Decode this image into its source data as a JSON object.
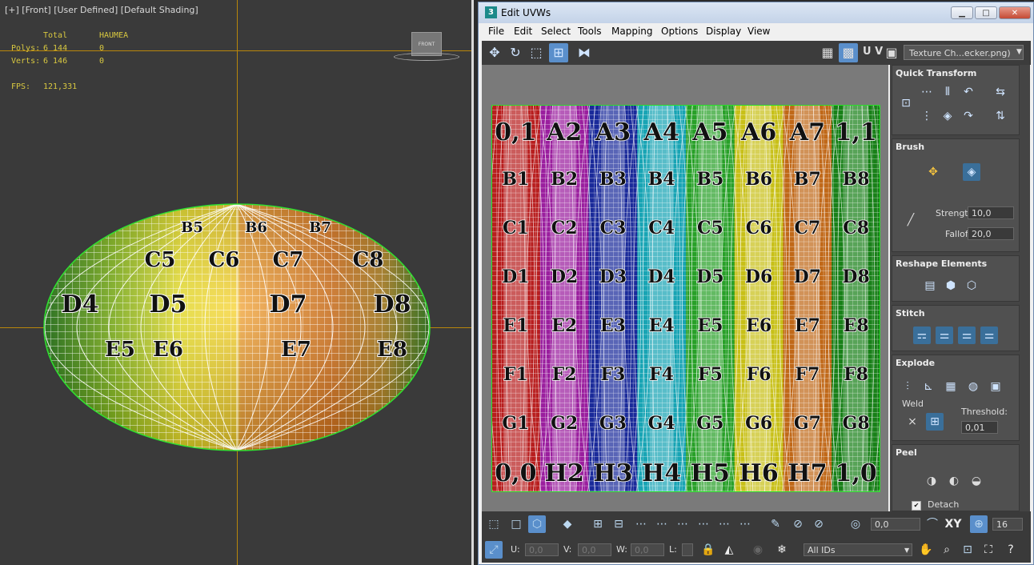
{
  "viewport": {
    "label": "[+] [Front] [User Defined] [Default Shading]",
    "stats": {
      "col_total": "Total",
      "col_object": "HAUMEA",
      "polys_label": "Polys:",
      "polys_total": "6 144",
      "polys_object": "0",
      "verts_label": "Verts:",
      "verts_total": "6 146",
      "verts_object": "0",
      "fps_label": "FPS:",
      "fps_value": "121,331"
    },
    "viewcube_label": "FRONT",
    "sphere_text": {
      "row1": [
        "B5",
        "B6",
        "B7"
      ],
      "row2": [
        "C5",
        "C6",
        "C7",
        "C8"
      ],
      "row3": [
        "D4",
        "D5",
        "D7",
        "D8"
      ],
      "row4": [
        "E5",
        "E6",
        "E7",
        "E8"
      ]
    }
  },
  "window": {
    "title": "Edit UVWs",
    "icon": "3",
    "controls": [
      "minimize-icon",
      "maximize-icon",
      "close-icon"
    ]
  },
  "menu": [
    "File",
    "Edit",
    "Select",
    "Tools",
    "Mapping",
    "Options",
    "Display",
    "View"
  ],
  "toolbar": {
    "uv_label": "U V",
    "texture_select": "Texture Ch...ecker.png)"
  },
  "uvmap": {
    "colors": [
      "#b81e1e",
      "#9a1e9e",
      "#1a2a9a",
      "#18a4b4",
      "#28a028",
      "#c8c018",
      "#c06818",
      "#188018"
    ],
    "top_row": [
      "0,1",
      "A2",
      "A3",
      "A4",
      "A5",
      "A6",
      "A7",
      "1,1"
    ],
    "mid_letters": [
      "B",
      "C",
      "D",
      "E",
      "F",
      "G"
    ],
    "bottom_row": [
      "0,0",
      "H2",
      "H3",
      "H4",
      "H5",
      "H6",
      "H7",
      "1,0"
    ]
  },
  "panel": {
    "quick_transform": {
      "title": "Quick Transform"
    },
    "brush": {
      "title": "Brush",
      "strength_label": "Strength:",
      "strength_value": "10,0",
      "falloff_label": "Falloff:",
      "falloff_value": "20,0"
    },
    "reshape": {
      "title": "Reshape Elements"
    },
    "stitch": {
      "title": "Stitch"
    },
    "explode": {
      "title": "Explode",
      "weld_label": "Weld",
      "threshold_label": "Threshold:",
      "threshold_value": "0,01"
    },
    "peel": {
      "title": "Peel",
      "detach_label": "Detach"
    }
  },
  "bottom": {
    "rotate_value": "0,0",
    "xy_label": "XY",
    "grid_value": "16",
    "u_label": "U:",
    "u_value": "0,0",
    "v_label": "V:",
    "v_value": "0,0",
    "w_label": "W:",
    "w_value": "0,0",
    "l_label": "L:",
    "ids_select": "All IDs"
  }
}
